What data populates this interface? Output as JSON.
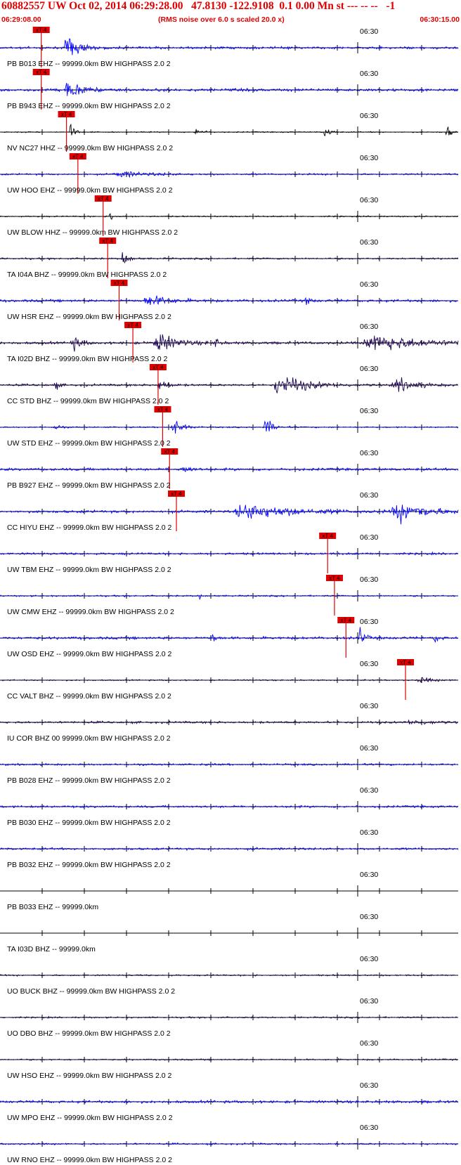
{
  "header": {
    "title": "60882557 UW Oct 02, 2014 06:29:28.00   47.8130 -122.9108  0.1 0.00 Mn st --- -- --   -1",
    "start_time": "06:29:08.00",
    "subtitle": "(RMS noise over 6.0 s scaled 20.0 x)",
    "end_time": "06:30:15.00"
  },
  "colors": {
    "header_text": "#e00000",
    "pick": "#e00000",
    "axis": "#000000",
    "blue_trace": "#0000ff",
    "dark_trace": "#1a0050",
    "black_trace": "#000000"
  },
  "traces": [
    {
      "label": "PB B013 EHZ -- 99999.0km BW  HIGHPASS  2.0  2",
      "time": "06:30",
      "pick": "xT 4",
      "pick_frac": 0.09,
      "color": "blue",
      "amp": 0.11,
      "events": [
        {
          "f": 0.15,
          "a": 1.0,
          "w": 0.035
        }
      ]
    },
    {
      "label": "PB B943 EHZ -- 99999.0km BW  HIGHPASS  2.0  2",
      "time": "06:30",
      "pick": "xT 4",
      "pick_frac": 0.09,
      "color": "blue",
      "amp": 0.13,
      "events": [
        {
          "f": 0.15,
          "a": 0.9,
          "w": 0.035
        }
      ]
    },
    {
      "label": "NV NC27 HHZ -- 99999.0km BW  HIGHPASS  2.0  2",
      "time": "06:30",
      "pick": "xT 4",
      "pick_frac": 0.145,
      "color": "black",
      "amp": 0.05,
      "events": [
        {
          "f": 0.155,
          "a": 0.85,
          "w": 0.01
        },
        {
          "f": 0.43,
          "a": 0.6,
          "w": 0.013
        },
        {
          "f": 0.71,
          "a": 0.7,
          "w": 0.012
        },
        {
          "f": 0.975,
          "a": 0.8,
          "w": 0.01
        }
      ]
    },
    {
      "label": "UW HOO EHZ -- 99999.0km BW  HIGHPASS  2.0  2",
      "time": "06:30",
      "pick": "xT 4",
      "pick_frac": 0.17,
      "color": "blue",
      "amp": 0.08,
      "events": [
        {
          "f": 0.27,
          "a": 0.25,
          "w": 0.08
        }
      ]
    },
    {
      "label": "UW BLOW HHZ -- 99999.0km BW  HIGHPASS  2.0  2",
      "time": "06:30",
      "pick": "xT 4",
      "pick_frac": 0.225,
      "color": "black",
      "amp": 0.06,
      "events": [
        {
          "f": 0.24,
          "a": 0.9,
          "w": 0.008
        }
      ]
    },
    {
      "label": "TA I04A BHZ -- 99999.0km BW  HIGHPASS  2.0  2",
      "time": "06:30",
      "pick": "xT 4",
      "pick_frac": 0.235,
      "color": "dark",
      "amp": 0.08,
      "events": [
        {
          "f": 0.27,
          "a": 0.75,
          "w": 0.015
        }
      ]
    },
    {
      "label": "UW HSR EHZ -- 99999.0km BW  HIGHPASS  2.0  2",
      "time": "06:30",
      "pick": "xT 4",
      "pick_frac": 0.26,
      "color": "blue",
      "amp": 0.12,
      "events": [
        {
          "f": 0.33,
          "a": 0.5,
          "w": 0.05
        },
        {
          "f": 0.67,
          "a": 0.45,
          "w": 0.01
        }
      ]
    },
    {
      "label": "TA I02D BHZ -- 99999.0km BW  HIGHPASS  2.0  2",
      "time": "06:30",
      "pick": "xT 4",
      "pick_frac": 0.29,
      "color": "dark",
      "amp": 0.12,
      "events": [
        {
          "f": 0.16,
          "a": 0.7,
          "w": 0.02
        },
        {
          "f": 0.35,
          "a": 0.9,
          "w": 0.05
        },
        {
          "f": 0.47,
          "a": 0.5,
          "w": 0.01
        },
        {
          "f": 0.83,
          "a": 0.8,
          "w": 0.12
        }
      ]
    },
    {
      "label": "CC STD BHZ -- 99999.0km BW  HIGHPASS  2.0  2",
      "time": "06:30",
      "pick": "xT 4",
      "pick_frac": 0.345,
      "color": "dark",
      "amp": 0.1,
      "events": [
        {
          "f": 0.12,
          "a": 0.5,
          "w": 0.01
        },
        {
          "f": 0.35,
          "a": 0.6,
          "w": 0.02
        },
        {
          "f": 0.62,
          "a": 1.0,
          "w": 0.07
        },
        {
          "f": 0.87,
          "a": 0.6,
          "w": 0.05
        }
      ]
    },
    {
      "label": "UW STD EHZ -- 99999.0km BW  HIGHPASS  2.0  2",
      "time": "06:30",
      "pick": "xT 4",
      "pick_frac": 0.355,
      "color": "blue",
      "amp": 0.06,
      "events": [
        {
          "f": 0.12,
          "a": 0.6,
          "w": 0.01
        },
        {
          "f": 0.38,
          "a": 0.8,
          "w": 0.025
        },
        {
          "f": 0.58,
          "a": 1.0,
          "w": 0.02
        }
      ]
    },
    {
      "label": "PB B927 EHZ -- 99999.0km BW  HIGHPASS  2.0  2",
      "time": "06:30",
      "pick": "xT 4",
      "pick_frac": 0.37,
      "color": "blue",
      "amp": 0.12,
      "events": [
        {
          "f": 0.4,
          "a": 0.5,
          "w": 0.02
        }
      ]
    },
    {
      "label": "CC HIYU EHZ -- 99999.0km BW  HIGHPASS  2.0  2",
      "time": "06:30",
      "pick": "xT 4",
      "pick_frac": 0.385,
      "color": "blue",
      "amp": 0.12,
      "events": [
        {
          "f": 0.55,
          "a": 0.75,
          "w": 0.12
        },
        {
          "f": 0.88,
          "a": 0.85,
          "w": 0.08
        }
      ]
    },
    {
      "label": "UW TBM EHZ -- 99999.0km BW  HIGHPASS  2.0  2",
      "time": "06:30",
      "pick": "xT 4",
      "pick_frac": 0.715,
      "color": "blue",
      "amp": 0.1,
      "events": []
    },
    {
      "label": "UW CMW EHZ -- 99999.0km BW  HIGHPASS  2.0  2",
      "time": "06:30",
      "pick": "xT 4",
      "pick_frac": 0.73,
      "color": "blue",
      "amp": 0.07,
      "events": [
        {
          "f": 0.435,
          "a": 0.7,
          "w": 0.004
        }
      ]
    },
    {
      "label": "UW OSD EHZ -- 99999.0km BW  HIGHPASS  2.0  2",
      "time": "06:30",
      "pick": "xT 4",
      "pick_frac": 0.755,
      "color": "blue",
      "amp": 0.12,
      "events": [
        {
          "f": 0.465,
          "a": 0.8,
          "w": 0.006
        },
        {
          "f": 0.785,
          "a": 1.0,
          "w": 0.012
        },
        {
          "f": 0.95,
          "a": 0.4,
          "w": 0.012
        }
      ]
    },
    {
      "label": "CC VALT BHZ -- 99999.0km BW  HIGHPASS  2.0  2",
      "time": "06:30",
      "pick": "xT 4",
      "pick_frac": 0.885,
      "color": "dark",
      "amp": 0.06,
      "events": [
        {
          "f": 0.92,
          "a": 0.3,
          "w": 0.03
        }
      ]
    },
    {
      "label": "IU COR BHZ 00 99999.0km BW  HIGHPASS  2.0  2",
      "time": "06:30",
      "pick": "",
      "pick_frac": null,
      "color": "dark",
      "amp": 0.1,
      "events": [
        {
          "f": 0.9,
          "a": 0.2,
          "w": 0.06
        }
      ]
    },
    {
      "label": "PB B028 EHZ -- 99999.0km BW  HIGHPASS  2.0  2",
      "time": "06:30",
      "pick": "",
      "pick_frac": null,
      "color": "blue",
      "amp": 0.09,
      "events": []
    },
    {
      "label": "PB B030 EHZ -- 99999.0km BW  HIGHPASS  2.0  2",
      "time": "06:30",
      "pick": "",
      "pick_frac": null,
      "color": "blue",
      "amp": 0.1,
      "events": []
    },
    {
      "label": "PB B032 EHZ -- 99999.0km BW  HIGHPASS  2.0  2",
      "time": "06:30",
      "pick": "",
      "pick_frac": null,
      "color": "blue",
      "amp": 0.1,
      "events": []
    },
    {
      "label": "PB B033 EHZ -- 99999.0km",
      "time": "06:30",
      "pick": "",
      "pick_frac": null,
      "color": "none",
      "amp": 0,
      "events": []
    },
    {
      "label": "TA I03D BHZ -- 99999.0km",
      "time": "06:30",
      "pick": "",
      "pick_frac": null,
      "color": "none",
      "amp": 0,
      "events": []
    },
    {
      "label": "UO BUCK BHZ -- 99999.0km BW  HIGHPASS  2.0  2",
      "time": "06:30",
      "pick": "",
      "pick_frac": null,
      "color": "dark",
      "amp": 0.07,
      "events": []
    },
    {
      "label": "UO DBO BHZ -- 99999.0km BW  HIGHPASS  2.0  2",
      "time": "06:30",
      "pick": "",
      "pick_frac": null,
      "color": "dark",
      "amp": 0.07,
      "events": []
    },
    {
      "label": "UW HSO EHZ -- 99999.0km BW  HIGHPASS  2.0  2",
      "time": "06:30",
      "pick": "",
      "pick_frac": null,
      "color": "dark",
      "amp": 0.07,
      "events": []
    },
    {
      "label": "UW MPO EHZ -- 99999.0km BW  HIGHPASS  2.0  2",
      "time": "06:30",
      "pick": "",
      "pick_frac": null,
      "color": "blue",
      "amp": 0.12,
      "events": []
    },
    {
      "label": "UW RNO EHZ -- 99999.0km BW  HIGHPASS  2.0  2",
      "time": "06:30",
      "pick": "",
      "pick_frac": null,
      "color": "blue",
      "amp": 0.08,
      "events": []
    }
  ]
}
